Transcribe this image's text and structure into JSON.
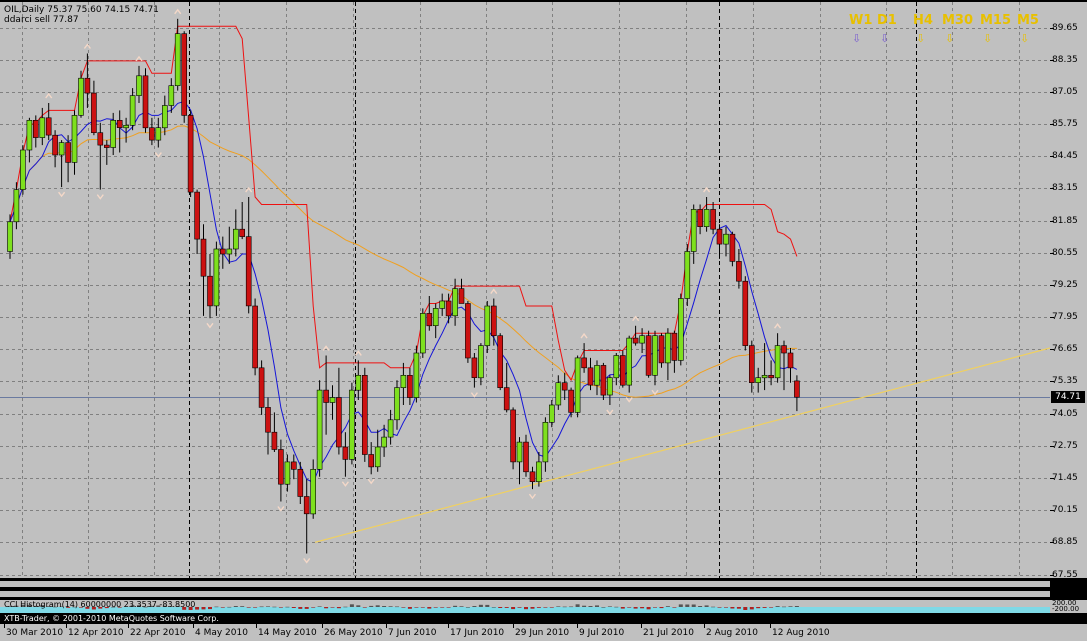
{
  "chart_header": {
    "line1": "OIL,Daily  75.37 75.60 74.15 74.71",
    "line2": "ddarci sell 77.87"
  },
  "timeframes": {
    "labels": [
      "W1",
      "D1",
      "H4",
      "M30",
      "M15",
      "M5"
    ],
    "arrows": [
      "⇩",
      "⇩",
      "⇩",
      "⇩",
      "⇩",
      "⇩"
    ],
    "arrow_colors": [
      "#7b5fd0",
      "#7b5fd0",
      "#e8c000",
      "#e8c000",
      "#e8c000",
      "#e8c000"
    ]
  },
  "last_price": "74.71",
  "indicator_label": "CCI Histogram(14) 60000000 23.3537 -83.8500",
  "indicator_axis": [
    "200.00",
    "-200.00"
  ],
  "copyright": "XTB-Trader, © 2001-2010 MetaQuotes Software Corp.",
  "colors": {
    "background": "#c0c0c0",
    "bull": "#7ee01e",
    "bear": "#cc1111",
    "ma_fast": "#1515d8",
    "ma_mid": "#ee1111",
    "ma_slow": "#f0a020",
    "trendline": "#f0d060",
    "grid": "#808080"
  },
  "chart_data": {
    "type": "candlestick",
    "symbol": "OIL",
    "period": "Daily",
    "ylim": [
      67.0,
      90.5
    ],
    "y_ticks": [
      "89.65",
      "88.35",
      "87.05",
      "85.75",
      "84.45",
      "83.15",
      "81.85",
      "80.55",
      "79.25",
      "77.95",
      "76.65",
      "75.35",
      "74.05",
      "72.75",
      "71.45",
      "70.15",
      "68.85",
      "67.55"
    ],
    "x_ticks": [
      "30 Mar 2010",
      "12 Apr 2010",
      "22 Apr 2010",
      "4 May 2010",
      "14 May 2010",
      "26 May 2010",
      "7 Jun 2010",
      "17 Jun 2010",
      "29 Jun 2010",
      "9 Jul 2010",
      "21 Jul 2010",
      "2 Aug 2010",
      "12 Aug 2010"
    ],
    "candles": [
      [
        80.6,
        82.1,
        80.3,
        81.8
      ],
      [
        81.8,
        83.4,
        81.5,
        83.1
      ],
      [
        83.1,
        84.9,
        82.9,
        84.7
      ],
      [
        84.7,
        86.0,
        84.2,
        85.9
      ],
      [
        85.9,
        86.1,
        84.8,
        85.2
      ],
      [
        85.2,
        86.4,
        84.9,
        86.0
      ],
      [
        86.0,
        86.6,
        85.1,
        85.3
      ],
      [
        85.3,
        85.5,
        84.0,
        84.5
      ],
      [
        84.5,
        85.1,
        83.2,
        85.0
      ],
      [
        85.0,
        85.3,
        83.4,
        84.2
      ],
      [
        84.2,
        86.3,
        83.7,
        86.1
      ],
      [
        86.1,
        87.9,
        86.0,
        87.6
      ],
      [
        87.6,
        88.6,
        86.4,
        87.0
      ],
      [
        87.0,
        87.5,
        85.3,
        85.4
      ],
      [
        85.4,
        85.8,
        83.1,
        84.9
      ],
      [
        84.9,
        85.1,
        84.1,
        84.8
      ],
      [
        84.8,
        86.2,
        84.5,
        85.9
      ],
      [
        85.9,
        86.3,
        84.6,
        85.6
      ],
      [
        85.6,
        86.0,
        85.0,
        85.7
      ],
      [
        85.7,
        87.2,
        85.5,
        86.9
      ],
      [
        86.9,
        88.1,
        86.6,
        87.7
      ],
      [
        87.7,
        88.0,
        85.4,
        85.6
      ],
      [
        85.6,
        86.0,
        84.9,
        85.1
      ],
      [
        85.1,
        86.0,
        84.8,
        85.6
      ],
      [
        85.6,
        86.9,
        85.3,
        86.5
      ],
      [
        86.5,
        87.6,
        86.2,
        87.3
      ],
      [
        87.3,
        90.0,
        87.1,
        89.4
      ],
      [
        89.4,
        89.5,
        85.8,
        86.1
      ],
      [
        86.1,
        86.3,
        82.8,
        83.0
      ],
      [
        83.0,
        83.1,
        80.5,
        81.1
      ],
      [
        81.1,
        81.7,
        78.0,
        79.6
      ],
      [
        79.6,
        80.5,
        77.9,
        78.4
      ],
      [
        78.4,
        81.0,
        78.0,
        80.7
      ],
      [
        80.7,
        81.2,
        79.9,
        80.5
      ],
      [
        80.5,
        81.6,
        80.1,
        80.7
      ],
      [
        80.7,
        82.3,
        80.4,
        81.5
      ],
      [
        81.5,
        82.6,
        81.1,
        81.2
      ],
      [
        81.2,
        82.8,
        78.1,
        78.4
      ],
      [
        78.4,
        78.7,
        75.6,
        75.9
      ],
      [
        75.9,
        76.2,
        74.0,
        74.3
      ],
      [
        74.3,
        74.7,
        72.4,
        73.3
      ],
      [
        73.3,
        74.1,
        72.5,
        72.6
      ],
      [
        72.6,
        73.0,
        70.5,
        71.2
      ],
      [
        71.2,
        72.4,
        70.9,
        72.1
      ],
      [
        72.1,
        72.4,
        71.4,
        71.8
      ],
      [
        71.8,
        72.1,
        70.4,
        70.7
      ],
      [
        70.7,
        71.4,
        68.4,
        70.0
      ],
      [
        70.0,
        72.2,
        69.8,
        71.8
      ],
      [
        71.8,
        75.4,
        71.5,
        75.0
      ],
      [
        75.0,
        76.4,
        73.2,
        74.5
      ],
      [
        74.5,
        75.2,
        73.8,
        74.7
      ],
      [
        74.7,
        75.9,
        72.4,
        72.7
      ],
      [
        72.7,
        73.3,
        71.5,
        72.2
      ],
      [
        72.2,
        75.3,
        72.0,
        75.0
      ],
      [
        75.0,
        76.2,
        74.6,
        75.6
      ],
      [
        75.6,
        75.9,
        72.1,
        72.4
      ],
      [
        72.4,
        72.9,
        71.6,
        71.9
      ],
      [
        71.9,
        73.4,
        71.7,
        72.7
      ],
      [
        72.7,
        73.6,
        72.3,
        73.1
      ],
      [
        73.1,
        74.2,
        72.8,
        73.8
      ],
      [
        73.8,
        75.4,
        73.4,
        75.1
      ],
      [
        75.1,
        76.1,
        74.4,
        75.6
      ],
      [
        75.6,
        75.9,
        74.4,
        74.7
      ],
      [
        74.7,
        76.8,
        74.5,
        76.5
      ],
      [
        76.5,
        78.3,
        76.3,
        78.1
      ],
      [
        78.1,
        78.8,
        77.4,
        77.6
      ],
      [
        77.6,
        78.5,
        77.1,
        78.3
      ],
      [
        78.3,
        78.9,
        78.0,
        78.6
      ],
      [
        78.6,
        78.9,
        77.7,
        78.0
      ],
      [
        78.0,
        79.5,
        77.6,
        79.1
      ],
      [
        79.1,
        79.5,
        78.7,
        78.5
      ],
      [
        78.5,
        78.6,
        76.1,
        76.3
      ],
      [
        76.3,
        76.5,
        75.1,
        75.5
      ],
      [
        75.5,
        76.9,
        75.2,
        76.8
      ],
      [
        76.8,
        78.6,
        76.5,
        78.4
      ],
      [
        78.4,
        78.7,
        76.8,
        77.2
      ],
      [
        77.2,
        77.3,
        75.0,
        75.1
      ],
      [
        75.1,
        76.1,
        74.1,
        74.2
      ],
      [
        74.2,
        74.3,
        71.8,
        72.1
      ],
      [
        72.1,
        73.1,
        71.2,
        72.9
      ],
      [
        72.9,
        73.2,
        71.5,
        71.7
      ],
      [
        71.7,
        71.9,
        71.0,
        71.3
      ],
      [
        71.3,
        72.5,
        71.1,
        72.1
      ],
      [
        72.1,
        73.9,
        71.7,
        73.7
      ],
      [
        73.7,
        74.6,
        73.5,
        74.4
      ],
      [
        74.4,
        75.6,
        74.2,
        75.3
      ],
      [
        75.3,
        75.7,
        74.6,
        75.0
      ],
      [
        75.0,
        75.1,
        73.9,
        74.1
      ],
      [
        74.1,
        76.4,
        73.9,
        76.3
      ],
      [
        76.3,
        76.9,
        75.7,
        75.9
      ],
      [
        75.9,
        76.3,
        75.0,
        75.2
      ],
      [
        75.2,
        76.2,
        74.8,
        76.0
      ],
      [
        76.0,
        76.1,
        74.6,
        74.8
      ],
      [
        74.8,
        75.6,
        74.4,
        75.5
      ],
      [
        75.5,
        76.5,
        75.2,
        76.4
      ],
      [
        76.4,
        76.6,
        75.1,
        75.2
      ],
      [
        75.2,
        77.2,
        74.9,
        77.1
      ],
      [
        77.1,
        77.6,
        76.8,
        76.9
      ],
      [
        76.9,
        77.5,
        76.5,
        77.2
      ],
      [
        77.2,
        77.4,
        75.5,
        75.6
      ],
      [
        75.6,
        77.4,
        75.2,
        77.2
      ],
      [
        77.2,
        77.3,
        75.9,
        76.1
      ],
      [
        76.1,
        77.5,
        75.4,
        77.3
      ],
      [
        77.3,
        77.4,
        75.7,
        76.2
      ],
      [
        76.2,
        78.9,
        76.0,
        78.7
      ],
      [
        78.7,
        80.9,
        78.4,
        80.6
      ],
      [
        80.6,
        82.5,
        80.1,
        82.3
      ],
      [
        82.3,
        82.5,
        81.3,
        81.6
      ],
      [
        81.6,
        82.8,
        81.4,
        82.3
      ],
      [
        82.3,
        82.6,
        81.3,
        81.5
      ],
      [
        81.5,
        81.7,
        80.3,
        80.9
      ],
      [
        80.9,
        81.6,
        80.4,
        81.3
      ],
      [
        81.3,
        81.4,
        80.0,
        80.2
      ],
      [
        80.2,
        80.7,
        79.1,
        79.4
      ],
      [
        79.4,
        79.6,
        76.6,
        76.8
      ],
      [
        76.8,
        77.0,
        74.9,
        75.3
      ],
      [
        75.3,
        75.9,
        74.9,
        75.5
      ],
      [
        75.5,
        76.9,
        75.0,
        75.6
      ],
      [
        75.6,
        76.2,
        75.2,
        75.5
      ],
      [
        75.5,
        77.3,
        75.3,
        76.8
      ],
      [
        76.8,
        77.0,
        75.0,
        76.5
      ],
      [
        76.5,
        76.7,
        75.3,
        75.9
      ],
      [
        75.37,
        75.6,
        74.15,
        74.71
      ]
    ],
    "series": [
      {
        "name": "ddarci sell",
        "last_value": 77.87
      }
    ]
  }
}
